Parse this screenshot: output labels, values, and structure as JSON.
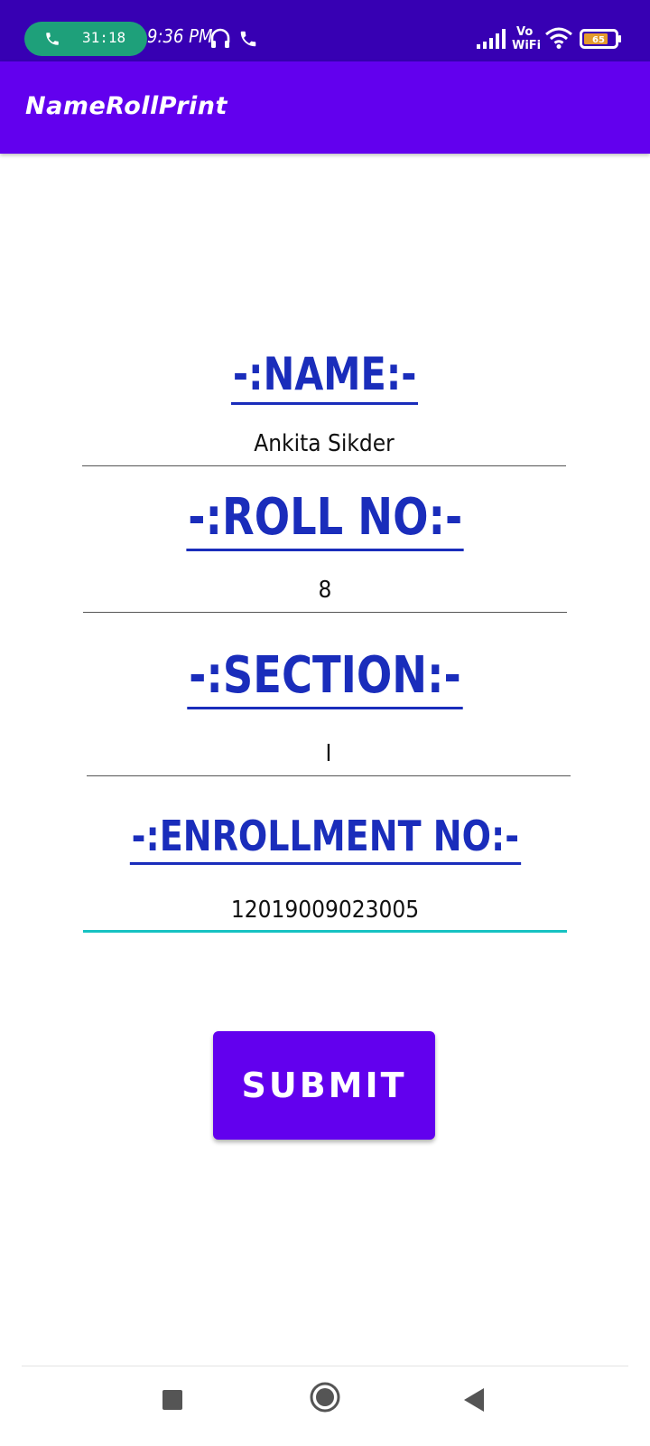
{
  "status_bar": {
    "call_timer": "31:18",
    "clock": "9:36 PM",
    "network_label": "Vo WiFi",
    "battery": "65",
    "icons": [
      "phone-icon",
      "headset-icon",
      "phone-icon",
      "signal-icon",
      "wifi-icon",
      "battery-icon"
    ]
  },
  "app_bar": {
    "title": "NameRollPrint"
  },
  "form": {
    "name_label": "-:NAME:-",
    "name_value": "Ankita Sikder",
    "roll_label": "-:ROLL NO:-",
    "roll_value": "8",
    "section_label": "-:SECTION:-",
    "section_value": "I",
    "enrollment_label": "-:ENROLLMENT NO:-",
    "enrollment_value": "12019009023005",
    "submit_label": "SUBMIT"
  },
  "navigation": {
    "icons": [
      "recents-icon",
      "home-icon",
      "back-icon"
    ]
  },
  "colors": {
    "status_bar": "#3700b3",
    "app_bar": "#6200ee",
    "label": "#1a2dbb",
    "focus_underline": "#17c2c2",
    "button": "#6200ee"
  }
}
